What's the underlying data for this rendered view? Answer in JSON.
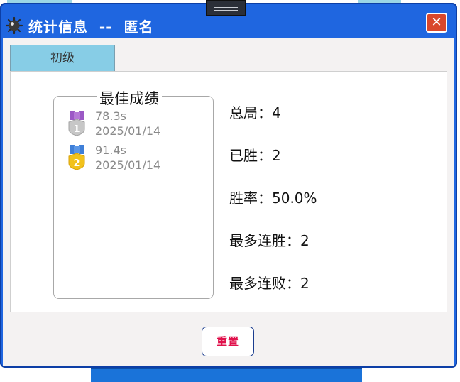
{
  "window": {
    "title": "统计信息  --  匿名",
    "close_symbol": "✕"
  },
  "tabs": [
    {
      "label": "初级",
      "selected": true
    }
  ],
  "best_scores": {
    "title": "最佳成绩",
    "records": [
      {
        "rank": 1,
        "time": "78.3s",
        "date": "2025/01/14",
        "medal_icon": "medal-silver-1-icon"
      },
      {
        "rank": 2,
        "time": "91.4s",
        "date": "2025/01/14",
        "medal_icon": "medal-gold-2-icon"
      }
    ]
  },
  "stats": {
    "total": "总局：4",
    "wins": "已胜：2",
    "win_rate": "胜率：50.0%",
    "max_win_streak": "最多连胜：2",
    "max_loss_streak": "最多连败：2"
  },
  "buttons": {
    "reset": "重置"
  },
  "colors": {
    "titlebar": "#1f66e0",
    "tab": "#87cde6",
    "reset_text": "#e0124c",
    "close": "#d9472b"
  }
}
